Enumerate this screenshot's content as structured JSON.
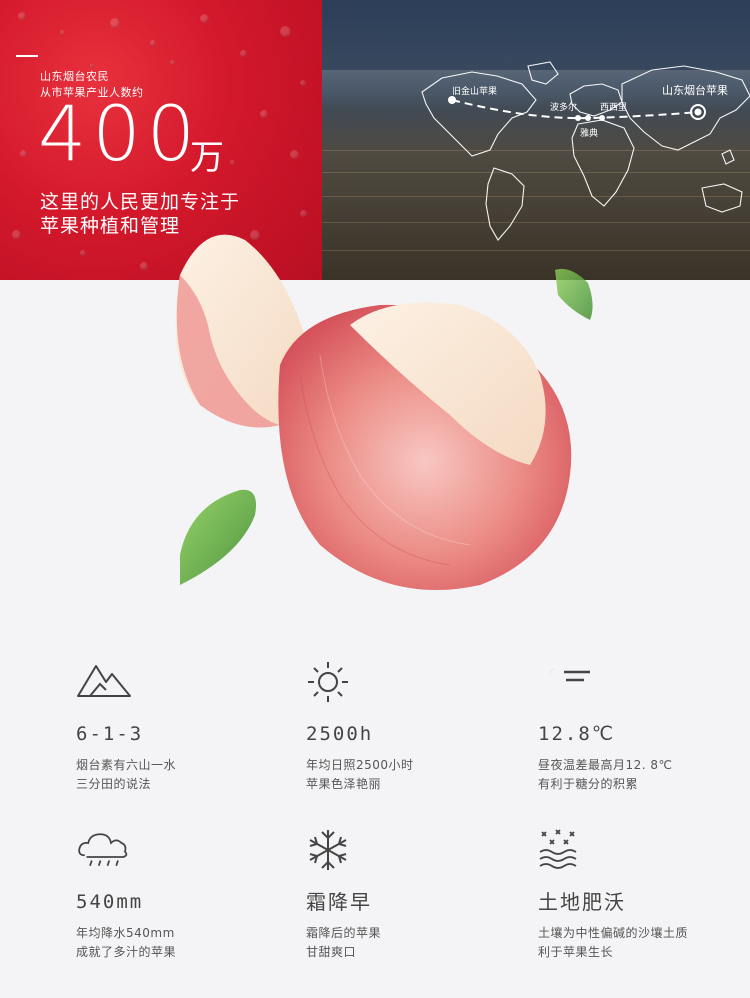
{
  "hero": {
    "small_line1": "山东烟台农民",
    "small_line2": "从市苹果产业人数约",
    "big_number": "400",
    "big_unit": "万",
    "desc_line1": "这里的人民更加专注于",
    "desc_line2": "苹果种植和管理"
  },
  "map": {
    "labels": {
      "san_francisco": "旧金山苹果",
      "boston": "波多尔",
      "sicily": "西西里",
      "athens": "雅典",
      "yantai": "山东烟台苹果"
    }
  },
  "features": [
    {
      "icon": "mountain-icon",
      "value": "6-1-3",
      "line1": "烟台素有六山一水",
      "line2": "三分田的说法"
    },
    {
      "icon": "sun-icon",
      "value": "2500h",
      "line1": "年均日照2500小时",
      "line2": "苹果色泽艳丽"
    },
    {
      "icon": "moon-sun-icon",
      "value": "12.8℃",
      "line1": "昼夜温差最高月12. 8℃",
      "line2": "有利于糖分的积累"
    },
    {
      "icon": "rain-cloud-icon",
      "value": "540mm",
      "line1": "年均降水540mm",
      "line2": "成就了多汁的苹果"
    },
    {
      "icon": "snowflake-icon",
      "value": "霜降早",
      "line1": "霜降后的苹果",
      "line2": "甘甜爽口"
    },
    {
      "icon": "soil-icon",
      "value": "土地肥沃",
      "line1": "土壤为中性偏碱的沙壤土质",
      "line2": "利于苹果生长"
    }
  ],
  "colors": {
    "red": "#d3182b",
    "text": "#444444",
    "bg": "#f4f4f6"
  }
}
